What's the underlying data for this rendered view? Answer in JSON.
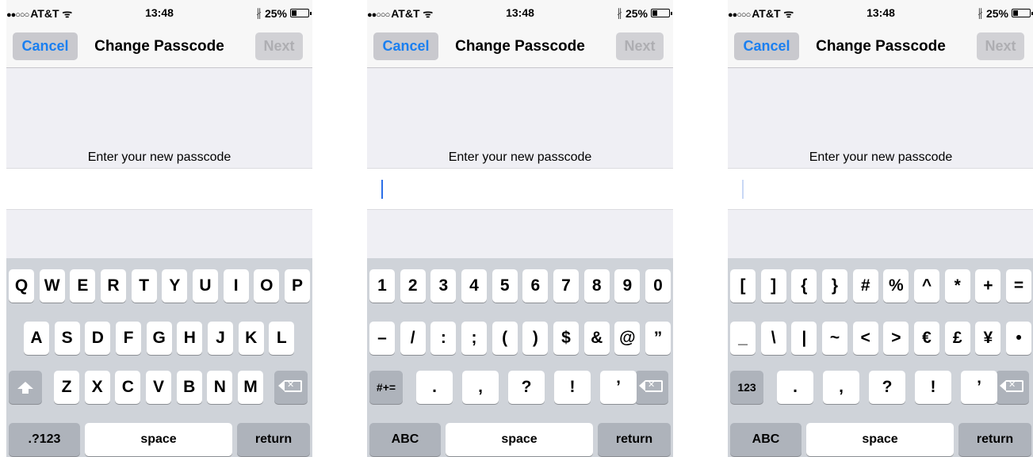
{
  "status": {
    "signal": "●●○○○",
    "carrier": "AT&T",
    "wifi": "ᯤ",
    "time": "13:48",
    "bluetooth": "∦",
    "battery": "25%"
  },
  "navbar": {
    "cancel": "Cancel",
    "title": "Change Passcode",
    "next": "Next"
  },
  "prompt": "Enter your new passcode",
  "icons": {
    "shift": "shift-icon",
    "delete": "delete-icon",
    "battery": "battery-icon",
    "bluetooth": "bluetooth-icon",
    "wifi": "wifi-icon"
  },
  "screens": [
    {
      "keyboard": "alpha",
      "cursor": "none",
      "rows": [
        [
          "Q",
          "W",
          "E",
          "R",
          "T",
          "Y",
          "U",
          "I",
          "O",
          "P"
        ],
        [
          "A",
          "S",
          "D",
          "F",
          "G",
          "H",
          "J",
          "K",
          "L"
        ],
        [
          "Z",
          "X",
          "C",
          "V",
          "B",
          "N",
          "M"
        ]
      ],
      "mode_key": ".?123",
      "space": "space",
      "return": "return"
    },
    {
      "keyboard": "numbers",
      "cursor": "active",
      "rows": [
        [
          "1",
          "2",
          "3",
          "4",
          "5",
          "6",
          "7",
          "8",
          "9",
          "0"
        ],
        [
          "–",
          "/",
          ":",
          ";",
          "(",
          ")",
          "$",
          "&",
          "@",
          "”"
        ],
        [
          ".",
          ",",
          "?",
          "!",
          "’"
        ]
      ],
      "shift_key": "#+=",
      "mode_key": "ABC",
      "space": "space",
      "return": "return"
    },
    {
      "keyboard": "symbols",
      "cursor": "faint",
      "rows": [
        [
          "[",
          "]",
          "{",
          "}",
          "#",
          "%",
          "^",
          "*",
          "+",
          "="
        ],
        [
          "_",
          "\\",
          "|",
          "~",
          "<",
          ">",
          "€",
          "£",
          "¥",
          "•"
        ],
        [
          ".",
          ",",
          "?",
          "!",
          "’"
        ]
      ],
      "shift_key": "123",
      "mode_key": "ABC",
      "space": "space",
      "return": "return"
    }
  ]
}
